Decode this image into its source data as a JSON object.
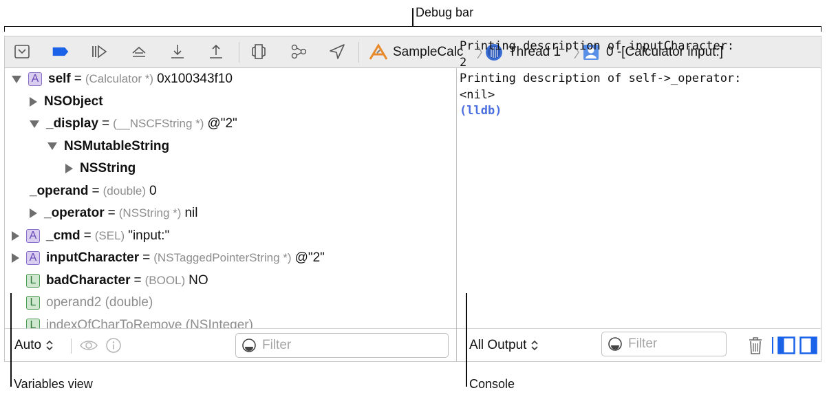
{
  "callouts": {
    "debug_bar": "Debug bar",
    "variables_view": "Variables view",
    "console": "Console"
  },
  "toolbar": {
    "icons": [
      "hide-debug-area-icon",
      "breakpoints-toggle-icon",
      "continue-icon",
      "step-over-icon",
      "step-into-icon",
      "step-out-icon",
      "debug-view-hierarchy-icon",
      "debug-memory-graph-icon",
      "simulate-location-icon"
    ],
    "breadcrumb": {
      "app": "SampleCalc",
      "thread": "Thread 1",
      "frame": "0 -[Calculator input:]"
    },
    "colors": {
      "breakpoint": "#1a62e8",
      "app_icon": "#e8892b"
    }
  },
  "variables": [
    {
      "name": "self",
      "badge": "A",
      "disclosure": "down",
      "type": "(Calculator *)",
      "value": "0x100343f10"
    },
    {
      "name": "NSObject",
      "badge": "",
      "disclosure": "right",
      "type": "",
      "value": ""
    },
    {
      "name": "_display",
      "badge": "",
      "disclosure": "down",
      "type": "(__NSCFString *)",
      "value": "@\"2\""
    },
    {
      "name": "NSMutableString",
      "badge": "",
      "disclosure": "down",
      "type": "",
      "value": ""
    },
    {
      "name": "NSString",
      "badge": "",
      "disclosure": "right",
      "type": "",
      "value": ""
    },
    {
      "name": "_operand",
      "badge": "",
      "disclosure": "",
      "type": "(double)",
      "value": "0"
    },
    {
      "name": "_operator",
      "badge": "",
      "disclosure": "right",
      "type": "(NSString *)",
      "value": "nil"
    },
    {
      "name": "_cmd",
      "badge": "A",
      "disclosure": "right",
      "type": "(SEL)",
      "value": "\"input:\""
    },
    {
      "name": "inputCharacter",
      "badge": "A",
      "disclosure": "right",
      "type": "(NSTaggedPointerString *)",
      "value": "@\"2\""
    },
    {
      "name": "badCharacter",
      "badge": "L",
      "disclosure": "",
      "type": "(BOOL)",
      "value": "NO"
    },
    {
      "name": "operand2 (double)",
      "badge": "L",
      "disclosure": "",
      "type": "",
      "value": ""
    },
    {
      "name": "indexOfCharToRemove (NSInteger)",
      "badge": "L",
      "disclosure": "",
      "type": "",
      "value": ""
    }
  ],
  "variables_footer": {
    "scope": "Auto",
    "filter_placeholder": "Filter"
  },
  "console": {
    "lines": [
      "Printing description of inputCharacter:",
      "2",
      "Printing description of self->_operator:",
      "<nil>"
    ],
    "prompt": "(lldb)"
  },
  "console_footer": {
    "output": "All Output",
    "filter_placeholder": "Filter"
  }
}
